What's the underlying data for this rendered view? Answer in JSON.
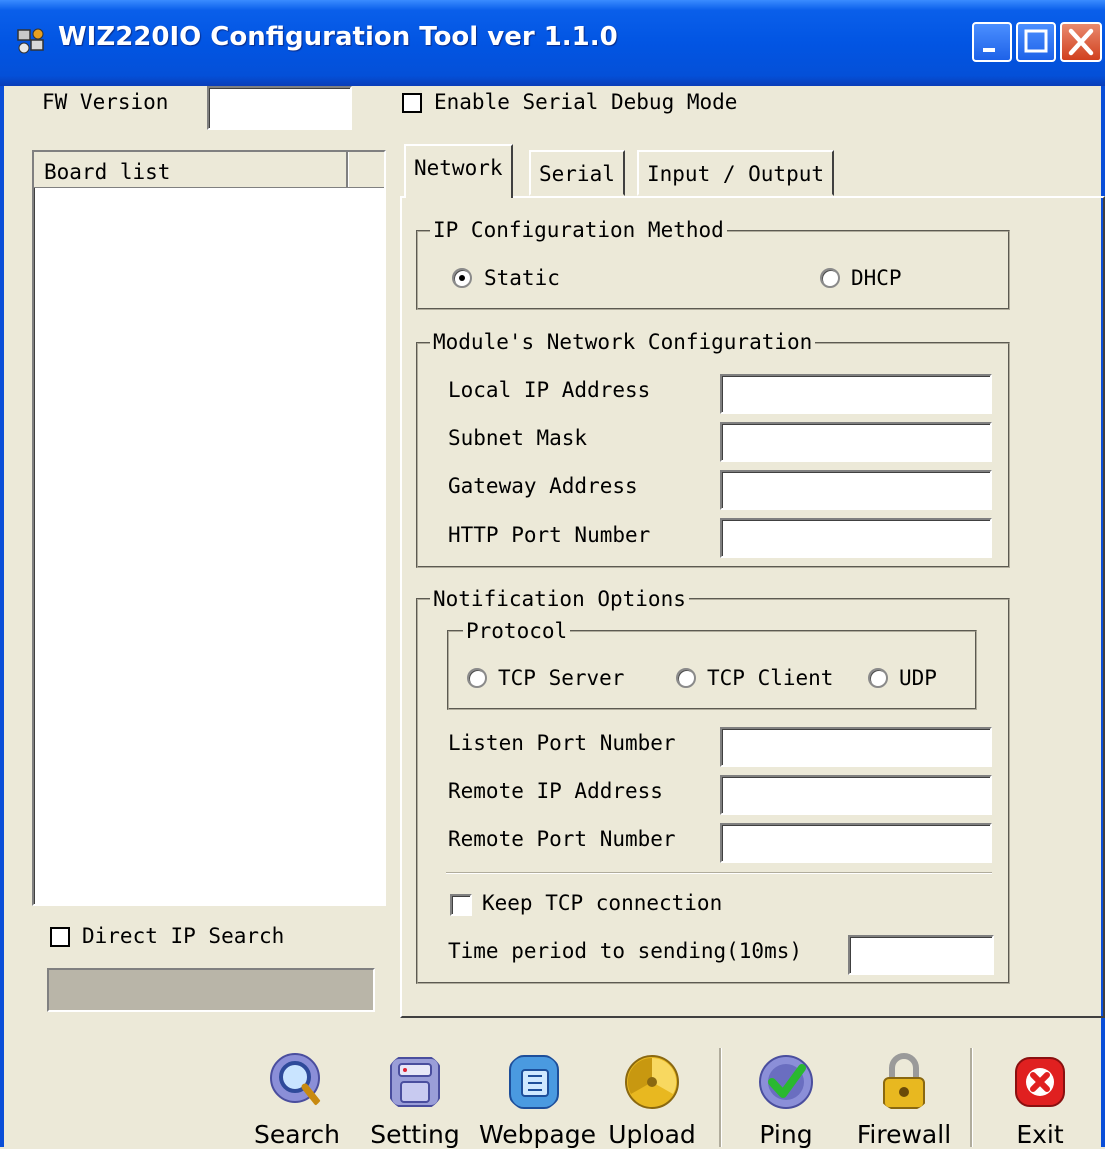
{
  "window": {
    "title": "WIZ220IO Configuration Tool ver 1.1.0",
    "controls": [
      "minimize",
      "maximize",
      "close"
    ]
  },
  "top": {
    "fw_version_label": "FW Version",
    "fw_version_value": "",
    "serial_debug_label": "Enable Serial Debug Mode",
    "serial_debug_checked": false
  },
  "board_list": {
    "header": "Board list",
    "items": [],
    "direct_ip_label": "Direct IP Search",
    "direct_ip_checked": false,
    "direct_ip_value": ""
  },
  "tabs": [
    {
      "label": "Network",
      "active": true
    },
    {
      "label": "Serial",
      "active": false
    },
    {
      "label": "Input / Output",
      "active": false
    }
  ],
  "ip_config": {
    "title": "IP Configuration Method",
    "static_label": "Static",
    "dhcp_label": "DHCP",
    "selected": "Static"
  },
  "network_config": {
    "title": "Module's Network Configuration",
    "fields": [
      {
        "label": "Local IP Address",
        "value": ""
      },
      {
        "label": "Subnet Mask",
        "value": ""
      },
      {
        "label": "Gateway Address",
        "value": ""
      },
      {
        "label": "HTTP Port Number",
        "value": ""
      }
    ]
  },
  "notification": {
    "title": "Notification Options",
    "protocol_title": "Protocol",
    "protocols": [
      "TCP Server",
      "TCP Client",
      "UDP"
    ],
    "fields": [
      {
        "label": "Listen Port Number",
        "value": ""
      },
      {
        "label": "Remote IP Address",
        "value": ""
      },
      {
        "label": "Remote Port Number",
        "value": ""
      }
    ],
    "keep_tcp_label": "Keep TCP connection",
    "keep_tcp_checked": false,
    "time_period_label": "Time period to sending(10ms)",
    "time_period_value": ""
  },
  "toolbar": {
    "buttons": [
      {
        "label": "Search",
        "icon": "search-icon"
      },
      {
        "label": "Setting",
        "icon": "setting-icon"
      },
      {
        "label": "Webpage",
        "icon": "webpage-icon"
      },
      {
        "label": "Upload",
        "icon": "upload-icon"
      },
      {
        "label": "Ping",
        "icon": "ping-icon"
      },
      {
        "label": "Firewall",
        "icon": "firewall-icon"
      },
      {
        "label": "Exit",
        "icon": "exit-icon"
      }
    ]
  }
}
